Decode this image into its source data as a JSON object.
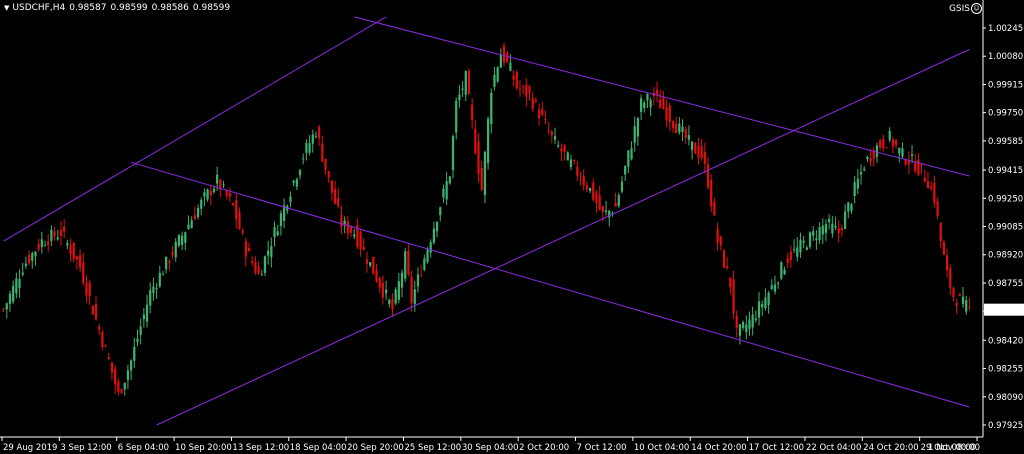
{
  "header": {
    "menu_icon": "triangle-down-icon",
    "symbol": "USDCHF,H4",
    "open": "0.98587",
    "high": "0.98599",
    "low": "0.98586",
    "close": "0.98599"
  },
  "indicator": {
    "label": "GSIS",
    "icon": "smiley-icon"
  },
  "colors": {
    "background": "#000000",
    "bull": "#3cb371",
    "bear": "#e01010",
    "channel": "#8a2be2",
    "axis": "#ffffff",
    "price_tag": "#ffffff"
  },
  "chart_data": {
    "type": "candlestick",
    "symbol": "USDCHF",
    "timeframe": "H4",
    "current_price": "0.98599",
    "y_ticks": [
      "1.00245",
      "1.00080",
      "0.99915",
      "0.99750",
      "0.99585",
      "0.99415",
      "0.99250",
      "0.99085",
      "0.98920",
      "0.98755",
      "0.98590",
      "0.98420",
      "0.98255",
      "0.98090",
      "0.97925"
    ],
    "x_ticks": [
      "29 Aug 2019",
      "3 Sep 12:00",
      "6 Sep 04:00",
      "10 Sep 20:00",
      "13 Sep 12:00",
      "18 Sep 04:00",
      "20 Sep 20:00",
      "25 Sep 12:00",
      "30 Sep 04:00",
      "2 Oct 20:00",
      "7 Oct 12:00",
      "10 Oct 04:00",
      "14 Oct 20:00",
      "17 Oct 12:00",
      "22 Oct 04:00",
      "24 Oct 20:00",
      "29 Oct 08:00",
      "1 Nov 00:00"
    ],
    "ylim": [
      0.97925,
      1.00245
    ],
    "close_path": [
      [
        0,
        0.986
      ],
      [
        6,
        0.9885
      ],
      [
        12,
        0.99
      ],
      [
        18,
        0.9905
      ],
      [
        24,
        0.9885
      ],
      [
        28,
        0.986
      ],
      [
        33,
        0.983
      ],
      [
        36,
        0.981
      ],
      [
        40,
        0.983
      ],
      [
        46,
        0.987
      ],
      [
        52,
        0.989
      ],
      [
        58,
        0.991
      ],
      [
        63,
        0.9925
      ],
      [
        67,
        0.9935
      ],
      [
        72,
        0.992
      ],
      [
        76,
        0.9895
      ],
      [
        80,
        0.988
      ],
      [
        85,
        0.9905
      ],
      [
        90,
        0.993
      ],
      [
        94,
        0.995
      ],
      [
        98,
        0.9965
      ],
      [
        102,
        0.9935
      ],
      [
        106,
        0.991
      ],
      [
        110,
        0.9905
      ],
      [
        114,
        0.989
      ],
      [
        118,
        0.9875
      ],
      [
        122,
        0.986
      ],
      [
        126,
        0.989
      ],
      [
        128,
        0.9865
      ],
      [
        132,
        0.989
      ],
      [
        136,
        0.9915
      ],
      [
        140,
        0.994
      ],
      [
        142,
        0.998
      ],
      [
        145,
        0.9995
      ],
      [
        148,
        0.9955
      ],
      [
        150,
        0.993
      ],
      [
        153,
        0.999
      ],
      [
        156,
        1.001
      ],
      [
        159,
        1.0
      ],
      [
        161,
        0.999
      ],
      [
        165,
        0.9985
      ],
      [
        168,
        0.9975
      ],
      [
        172,
        0.996
      ],
      [
        176,
        0.995
      ],
      [
        180,
        0.994
      ],
      [
        184,
        0.993
      ],
      [
        188,
        0.9915
      ],
      [
        192,
        0.992
      ],
      [
        196,
        0.995
      ],
      [
        200,
        0.998
      ],
      [
        204,
        0.9985
      ],
      [
        208,
        0.9975
      ],
      [
        212,
        0.9965
      ],
      [
        216,
        0.9955
      ],
      [
        219,
        0.995
      ],
      [
        221,
        0.9935
      ],
      [
        224,
        0.99
      ],
      [
        228,
        0.9875
      ],
      [
        230,
        0.9845
      ],
      [
        235,
        0.9855
      ],
      [
        240,
        0.987
      ],
      [
        246,
        0.989
      ],
      [
        252,
        0.99
      ],
      [
        258,
        0.991
      ],
      [
        262,
        0.9905
      ],
      [
        266,
        0.9925
      ],
      [
        270,
        0.9945
      ],
      [
        274,
        0.9955
      ],
      [
        278,
        0.996
      ],
      [
        282,
        0.995
      ],
      [
        286,
        0.9945
      ],
      [
        290,
        0.9935
      ],
      [
        292,
        0.9925
      ],
      [
        294,
        0.99
      ],
      [
        296,
        0.988
      ],
      [
        298,
        0.9868
      ],
      [
        303,
        0.986
      ]
    ],
    "channels": [
      {
        "name": "rising-channel-upper",
        "from": [
          0,
          0.99
        ],
        "to": [
          120,
          1.0031
        ]
      },
      {
        "name": "rising-channel-lower",
        "from": [
          48,
          0.97925
        ],
        "to": [
          303,
          1.0012
        ]
      },
      {
        "name": "falling-channel-upper",
        "from": [
          110,
          1.0031
        ],
        "to": [
          303,
          0.9938
        ]
      },
      {
        "name": "falling-channel-lower",
        "from": [
          40,
          0.9946
        ],
        "to": [
          303,
          0.9803
        ]
      }
    ]
  }
}
